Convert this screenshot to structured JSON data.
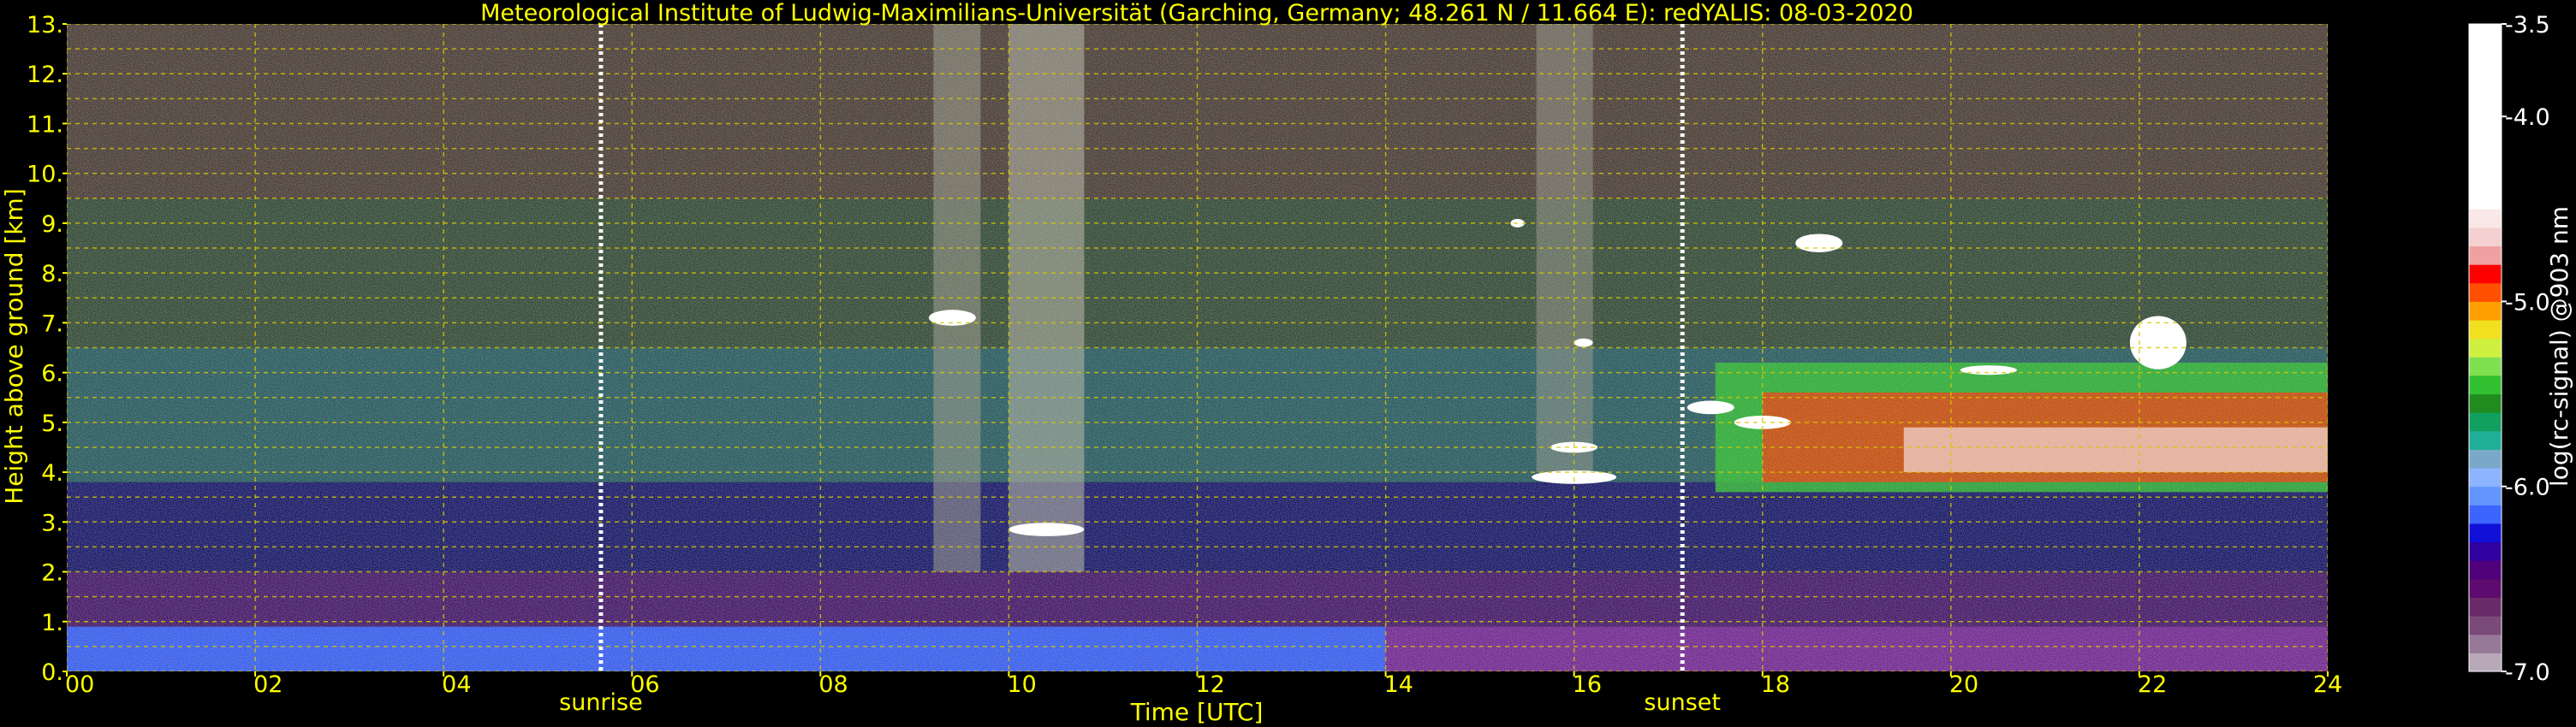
{
  "colors": {
    "background": "#000000",
    "text": "#ffff00",
    "grid": "#d8c800",
    "marker_line": "#ffffff",
    "colorbar_text": "#ffffff"
  },
  "chart_data": {
    "type": "heatmap",
    "title": "Meteorological Institute of Ludwig-Maximilians-Universität (Garching, Germany; 48.261 N / 11.664 E):    redYALIS: 08-03-2020",
    "xlabel": "Time [UTC]",
    "ylabel": "Height above ground [km]",
    "xlim": [
      0,
      24
    ],
    "ylim": [
      0,
      13
    ],
    "grid": true,
    "x_ticks": [
      {
        "value": 0,
        "label": "00"
      },
      {
        "value": 2,
        "label": "02"
      },
      {
        "value": 4,
        "label": "04"
      },
      {
        "value": 6,
        "label": "06"
      },
      {
        "value": 8,
        "label": "08"
      },
      {
        "value": 10,
        "label": "10"
      },
      {
        "value": 12,
        "label": "12"
      },
      {
        "value": 14,
        "label": "14"
      },
      {
        "value": 16,
        "label": "16"
      },
      {
        "value": 18,
        "label": "18"
      },
      {
        "value": 20,
        "label": "20"
      },
      {
        "value": 22,
        "label": "22"
      },
      {
        "value": 24,
        "label": "24"
      }
    ],
    "y_ticks": [
      {
        "value": 0,
        "label": "0."
      },
      {
        "value": 1,
        "label": "1."
      },
      {
        "value": 2,
        "label": "2."
      },
      {
        "value": 3,
        "label": "3."
      },
      {
        "value": 4,
        "label": "4."
      },
      {
        "value": 5,
        "label": "5."
      },
      {
        "value": 6,
        "label": "6."
      },
      {
        "value": 7,
        "label": "7."
      },
      {
        "value": 8,
        "label": "8."
      },
      {
        "value": 9,
        "label": "9."
      },
      {
        "value": 10,
        "label": "10."
      },
      {
        "value": 11,
        "label": "11."
      },
      {
        "value": 12,
        "label": "12."
      },
      {
        "value": 13,
        "label": "13."
      }
    ],
    "annotations": [
      {
        "name": "sunrise",
        "x": 5.67
      },
      {
        "name": "sunset",
        "x": 17.15
      }
    ],
    "colorbar": {
      "label": "log(rc-signal) @903 nm",
      "range": [
        -7.0,
        -3.5
      ],
      "ticks": [
        {
          "value": -3.5,
          "label": "-3.5"
        },
        {
          "value": -4.0,
          "label": "-4.0"
        },
        {
          "value": -5.0,
          "label": "-5.0"
        },
        {
          "value": -6.0,
          "label": "-6.0"
        },
        {
          "value": -7.0,
          "label": "-7.0"
        }
      ],
      "stops": [
        {
          "value": -7.0,
          "color": "#b8a8b8"
        },
        {
          "value": -6.9,
          "color": "#987898"
        },
        {
          "value": -6.8,
          "color": "#7a4a7a"
        },
        {
          "value": -6.7,
          "color": "#6a2a6a"
        },
        {
          "value": -6.6,
          "color": "#5e0a6e"
        },
        {
          "value": -6.5,
          "color": "#50007a"
        },
        {
          "value": -6.4,
          "color": "#3000a0"
        },
        {
          "value": -6.3,
          "color": "#1010d8"
        },
        {
          "value": -6.2,
          "color": "#3c64ff"
        },
        {
          "value": -6.1,
          "color": "#6494ff"
        },
        {
          "value": -6.0,
          "color": "#8cb4ff"
        },
        {
          "value": -5.9,
          "color": "#7aa8c8"
        },
        {
          "value": -5.8,
          "color": "#20b098"
        },
        {
          "value": -5.7,
          "color": "#10a060"
        },
        {
          "value": -5.6,
          "color": "#208c20"
        },
        {
          "value": -5.5,
          "color": "#30c030"
        },
        {
          "value": -5.4,
          "color": "#80e050"
        },
        {
          "value": -5.3,
          "color": "#d0f040"
        },
        {
          "value": -5.2,
          "color": "#f0e020"
        },
        {
          "value": -5.1,
          "color": "#ffa000"
        },
        {
          "value": -5.0,
          "color": "#ff5000"
        },
        {
          "value": -4.9,
          "color": "#ff0000"
        },
        {
          "value": -4.8,
          "color": "#f0a0a0"
        },
        {
          "value": -4.7,
          "color": "#f4d0d0"
        },
        {
          "value": -4.6,
          "color": "#fae8e8"
        },
        {
          "value": -4.5,
          "color": "#ffffff"
        },
        {
          "value": -3.5,
          "color": "#ffffff"
        }
      ]
    },
    "layers": [
      {
        "name": "surface-aerosol-layer",
        "x0": 0,
        "x1": 14,
        "y0": 0,
        "y1": 0.9,
        "color": "#3a64ff",
        "opacity": 0.95
      },
      {
        "name": "surface-aerosol-night",
        "x0": 14,
        "x1": 24,
        "y0": 0,
        "y1": 0.9,
        "color": "#7a2a9a",
        "opacity": 0.95
      },
      {
        "name": "residual-layer",
        "x0": 0,
        "x1": 24,
        "y0": 0.9,
        "y1": 2.0,
        "color": "#4a1a70",
        "opacity": 0.9
      },
      {
        "name": "lower-troposphere",
        "x0": 0,
        "x1": 24,
        "y0": 2.0,
        "y1": 3.8,
        "color": "#1a1a70",
        "opacity": 0.9
      },
      {
        "name": "mid-troposphere",
        "x0": 0,
        "x1": 24,
        "y0": 3.8,
        "y1": 6.5,
        "color": "#2c6a6a",
        "opacity": 0.85
      },
      {
        "name": "upper-troposphere",
        "x0": 0,
        "x1": 24,
        "y0": 6.5,
        "y1": 9.5,
        "color": "#3c5a3a",
        "opacity": 0.8
      },
      {
        "name": "upper-noise",
        "x0": 0,
        "x1": 24,
        "y0": 9.5,
        "y1": 13.0,
        "color": "#5a4a3a",
        "opacity": 0.8
      },
      {
        "name": "noise-column-a",
        "x0": 9.2,
        "x1": 9.7,
        "y0": 2.0,
        "y1": 13.0,
        "color": "#9a9a8a",
        "opacity": 0.55
      },
      {
        "name": "noise-column-b",
        "x0": 10.0,
        "x1": 10.8,
        "y0": 2.0,
        "y1": 13.0,
        "color": "#b0b0a0",
        "opacity": 0.6
      },
      {
        "name": "noise-column-c",
        "x0": 15.6,
        "x1": 16.2,
        "y0": 4.0,
        "y1": 13.0,
        "color": "#9a9a8a",
        "opacity": 0.5
      },
      {
        "name": "cloud-layer-green",
        "x0": 17.5,
        "x1": 24,
        "y0": 3.6,
        "y1": 6.2,
        "color": "#30c030",
        "opacity": 0.85
      },
      {
        "name": "cloud-layer-red",
        "x0": 18.0,
        "x1": 24,
        "y0": 3.8,
        "y1": 5.6,
        "color": "#ff3000",
        "opacity": 0.75
      },
      {
        "name": "cloud-core-white",
        "x0": 19.5,
        "x1": 24,
        "y0": 4.0,
        "y1": 4.9,
        "color": "#ffe0e0",
        "opacity": 0.7
      }
    ],
    "clouds": [
      {
        "name": "cloud-a",
        "x": 9.4,
        "y": 7.1,
        "w": 0.5,
        "h": 0.25
      },
      {
        "name": "cloud-b",
        "x": 10.4,
        "y": 2.85,
        "w": 0.8,
        "h": 0.2
      },
      {
        "name": "cloud-c",
        "x": 16.0,
        "y": 3.9,
        "w": 0.9,
        "h": 0.2
      },
      {
        "name": "cloud-d",
        "x": 16.0,
        "y": 4.5,
        "w": 0.5,
        "h": 0.15
      },
      {
        "name": "cloud-e",
        "x": 17.45,
        "y": 5.3,
        "w": 0.5,
        "h": 0.2
      },
      {
        "name": "cloud-f",
        "x": 18.0,
        "y": 5.0,
        "w": 0.6,
        "h": 0.2
      },
      {
        "name": "cloud-g",
        "x": 16.1,
        "y": 6.6,
        "w": 0.2,
        "h": 0.1
      },
      {
        "name": "cloud-h",
        "x": 15.4,
        "y": 9.0,
        "w": 0.15,
        "h": 0.1
      },
      {
        "name": "cloud-i",
        "x": 20.4,
        "y": 6.05,
        "w": 0.6,
        "h": 0.12
      },
      {
        "name": "cloud-j",
        "x": 18.6,
        "y": 8.6,
        "w": 0.5,
        "h": 0.3
      },
      {
        "name": "cloud-k",
        "x": 22.2,
        "y": 6.6,
        "w": 0.6,
        "h": 1.0
      }
    ]
  }
}
